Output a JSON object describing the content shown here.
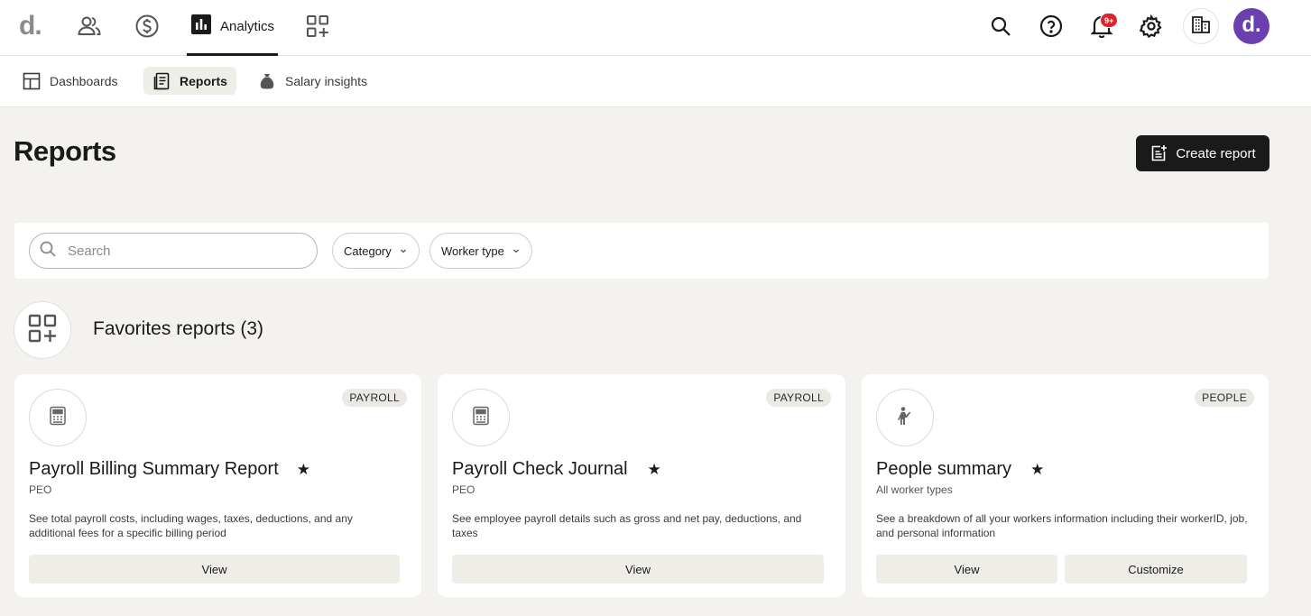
{
  "nav": {
    "logo": "d",
    "analytics_label": "Analytics",
    "notification_badge": "9+",
    "avatar_initial": "d."
  },
  "subnav": {
    "tabs": [
      {
        "label": "Dashboards",
        "icon": "dashboard-icon"
      },
      {
        "label": "Reports",
        "icon": "reports-icon",
        "active": true
      },
      {
        "label": "Salary insights",
        "icon": "money-bag-icon"
      }
    ]
  },
  "page": {
    "title": "Reports",
    "create_button": "Create report"
  },
  "filters": {
    "search_placeholder": "Search",
    "category_label": "Category",
    "worker_type_label": "Worker type"
  },
  "favorites": {
    "title": "Favorites reports (3)",
    "cards": [
      {
        "tag": "PAYROLL",
        "title": "Payroll Billing Summary Report",
        "subtitle": "PEO",
        "description": "See total payroll costs, including wages, taxes, deductions, and any additional fees for a specific billing period",
        "view_label": "View",
        "icon": "calculator-icon"
      },
      {
        "tag": "PAYROLL",
        "title": "Payroll Check Journal",
        "subtitle": "PEO",
        "description": "See employee payroll details such as gross and net pay, deductions, and taxes",
        "view_label": "View",
        "icon": "calculator-icon"
      },
      {
        "tag": "PEOPLE",
        "title": "People summary",
        "subtitle": "All worker types",
        "description": "See a breakdown of all your workers information including their workerID, job, and personal information",
        "view_label": "View",
        "customize_label": "Customize",
        "icon": "person-icon"
      }
    ]
  },
  "colors": {
    "accent_dark": "#1a1a1a",
    "avatar_bg": "#6b3fb0",
    "badge_red": "#d9262e",
    "page_bg": "#f4f2ee"
  }
}
